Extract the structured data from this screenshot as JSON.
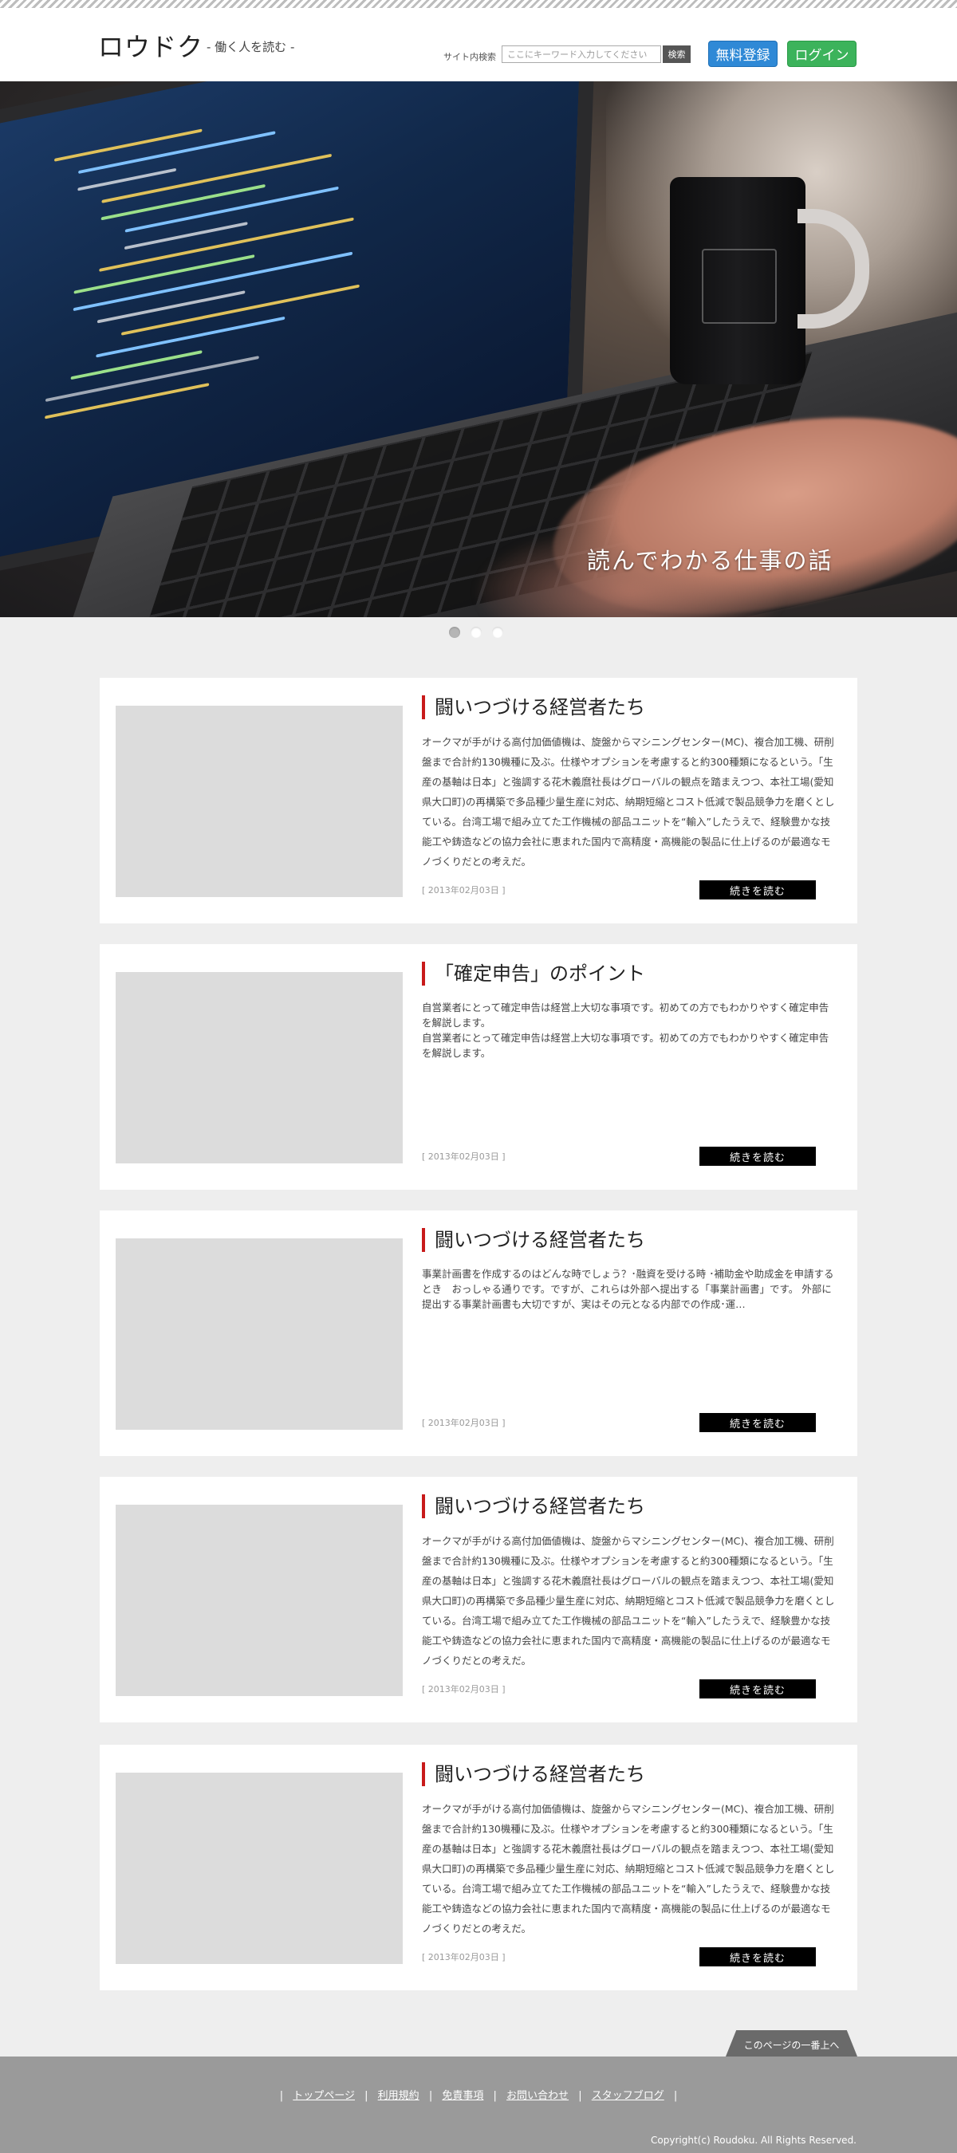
{
  "header": {
    "logo": "ロウドク",
    "tagline": "- 働く人を読む -",
    "search_label": "サイト内検索",
    "search_placeholder": "ここにキーワード入力してください",
    "search_button": "検索",
    "register_button": "無料登録",
    "login_button": "ログイン"
  },
  "hero": {
    "caption": "読んでわかる仕事の話"
  },
  "slider": {
    "dots": 3,
    "active_index": 0
  },
  "articles": [
    {
      "title": "闘いつづける経営者たち",
      "excerpt": "オークマが手がける高付加価値機は、旋盤からマシニングセンター(MC)、複合加工機、研削盤まで合計約130機種に及ぶ。仕様やオプションを考慮すると約300種類になるという。「生産の基軸は日本」と強調する花木義麿社長はグローバルの観点を踏まえつつ、本社工場(愛知県大口町)の再構築で多品種少量生産に対応、納期短縮とコスト低減で製品競争力を磨くとしている。台湾工場で組み立てた工作機械の部品ユニットを“輸入”したうえで、経験豊かな技能工や鋳造などの協力会社に恵まれた国内で高精度・高機能の製品に仕上げるのが最適なモノづくりだとの考えだ。",
      "date": "[ 2013年02月03日 ]",
      "more": "続きを読む"
    },
    {
      "title": "「確定申告」のポイント",
      "excerpt": "自営業者にとって確定申告は経営上大切な事項です。初めての方でもわかりやすく確定申告を解説します。\n自営業者にとって確定申告は経営上大切な事項です。初めての方でもわかりやすく確定申告を解説します。",
      "date": "[ 2013年02月03日 ]",
      "more": "続きを読む"
    },
    {
      "title": "闘いつづける経営者たち",
      "excerpt": "事業計画書を作成するのはどんな時でしょう？･融資を受ける時 ･補助金や助成金を申請するとき　おっしゃる通りです。ですが、これらは外部へ提出する「事業計画書」です。 外部に提出する事業計画書も大切ですが、実はその元となる内部での作成･運…",
      "date": "[ 2013年02月03日 ]",
      "more": "続きを読む"
    },
    {
      "title": "闘いつづける経営者たち",
      "excerpt": "オークマが手がける高付加価値機は、旋盤からマシニングセンター(MC)、複合加工機、研削盤まで合計約130機種に及ぶ。仕様やオプションを考慮すると約300種類になるという。「生産の基軸は日本」と強調する花木義麿社長はグローバルの観点を踏まえつつ、本社工場(愛知県大口町)の再構築で多品種少量生産に対応、納期短縮とコスト低減で製品競争力を磨くとしている。台湾工場で組み立てた工作機械の部品ユニットを“輸入”したうえで、経験豊かな技能工や鋳造などの協力会社に恵まれた国内で高精度・高機能の製品に仕上げるのが最適なモノづくりだとの考えだ。",
      "date": "[ 2013年02月03日 ]",
      "more": "続きを読む"
    },
    {
      "title": "闘いつづける経営者たち",
      "excerpt": "オークマが手がける高付加価値機は、旋盤からマシニングセンター(MC)、複合加工機、研削盤まで合計約130機種に及ぶ。仕様やオプションを考慮すると約300種類になるという。「生産の基軸は日本」と強調する花木義麿社長はグローバルの観点を踏まえつつ、本社工場(愛知県大口町)の再構築で多品種少量生産に対応、納期短縮とコスト低減で製品競争力を磨くとしている。台湾工場で組み立てた工作機械の部品ユニットを“輸入”したうえで、経験豊かな技能工や鋳造などの協力会社に恵まれた国内で高精度・高機能の製品に仕上げるのが最適なモノづくりだとの考えだ。",
      "date": "[ 2013年02月03日 ]",
      "more": "続きを読む"
    }
  ],
  "page_top": "このページの一番上へ",
  "footer": {
    "links": [
      "トップページ",
      "利用規約",
      "免責事項",
      "お問い合わせ",
      "スタッフブログ"
    ],
    "copyright": "Copyright(c) Roudoku. All Rights Reserved."
  },
  "colors": {
    "accent_red": "#c81a1a",
    "register_blue": "#2f89d6",
    "login_green": "#3cb35b",
    "page_bg": "#eeeeee",
    "footer_bg": "#9a9a9a"
  }
}
